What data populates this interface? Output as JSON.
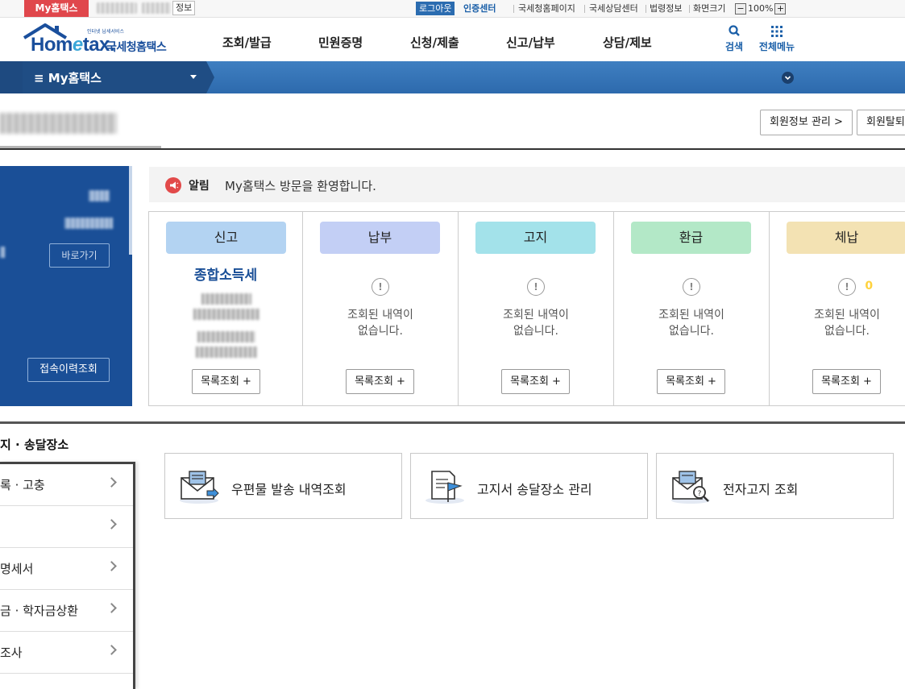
{
  "util": {
    "my_hometax_tab": "My홈택스",
    "user_info_suffix": "정보",
    "logout": "로그아웃",
    "cert_center": "인증센터",
    "nts_page": "국세청홈페이지",
    "counsel_center": "국세상담센터",
    "law_info": "법령정보",
    "screen_size": "화면크기",
    "zoom_minus": "−",
    "zoom_level": "100%",
    "zoom_plus": "+"
  },
  "header": {
    "logo_text_left": "Hom",
    "logo_text_e": "e",
    "logo_text_right": "tax.",
    "logo_korean": "국세청홈택스",
    "logo_tagline": "인터넷 납세서비스",
    "gnb": [
      "조회/발급",
      "민원증명",
      "신청/제출",
      "신고/납부",
      "상담/제보"
    ],
    "search": "검색",
    "all_menu": "전체메뉴"
  },
  "nav": {
    "my_menu": "≡  My홈택스"
  },
  "title_row": {
    "member_info_btn": "회원정보 관리 >",
    "withdraw_btn": "회원탈퇴"
  },
  "profile": {
    "shortcut": "바로가기",
    "count_num": "0",
    "count_unit": "건",
    "last_login": "2022.02.21.  16:35",
    "ip": "211.180.247.114",
    "history_btn": "접속이력조회"
  },
  "notice": {
    "label": "알림",
    "text": "My홈택스 방문을 환영합니다."
  },
  "cards": [
    {
      "title": "신고",
      "color": "#b3d3f2",
      "main": "종합소득세",
      "empty_line1": "",
      "empty_line2": "",
      "button": "목록조회 +"
    },
    {
      "title": "납부",
      "color": "#c3cff5",
      "main": "",
      "empty_line1": "조회된 내역이",
      "empty_line2": "없습니다.",
      "button": "목록조회 +"
    },
    {
      "title": "고지",
      "color": "#a3e2ea",
      "main": "",
      "empty_line1": "조회된 내역이",
      "empty_line2": "없습니다.",
      "button": "목록조회 +"
    },
    {
      "title": "환급",
      "color": "#b3e8c7",
      "main": "",
      "empty_line1": "조회된 내역이",
      "empty_line2": "없습니다.",
      "button": "목록조회 +"
    },
    {
      "title": "체납",
      "color": "#f3e2b3",
      "main": "",
      "empty_line1": "조회된 내역이",
      "empty_line2": "없습니다.",
      "button": "목록조회 +"
    }
  ],
  "bottom": {
    "section_title": "지 · 송달장소",
    "side_items": [
      "록 · 고충",
      "",
      "명세서",
      "금 · 학자금상환",
      "조사"
    ],
    "services": [
      "우편물 발송 내역조회",
      "고지서 송달장소 관리",
      "전자고지 조회"
    ]
  }
}
